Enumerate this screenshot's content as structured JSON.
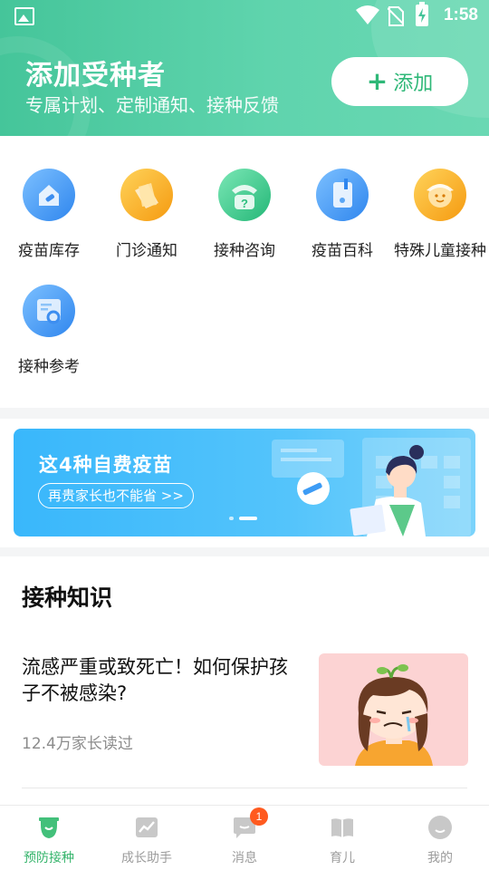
{
  "status_bar": {
    "time": "1:58"
  },
  "header": {
    "title": "添加受种者",
    "subtitle": "专属计划、定制通知、接种反馈",
    "add_button": {
      "plus": "+",
      "label": "添加"
    }
  },
  "quick_actions": [
    {
      "label": "疫苗库存",
      "icon": "vaccine-stock-icon",
      "color": "#3d9cf5"
    },
    {
      "label": "门诊通知",
      "icon": "clinic-notice-icon",
      "color": "#f8a71d"
    },
    {
      "label": "接种咨询",
      "icon": "consult-phone-icon",
      "color": "#3ec88a"
    },
    {
      "label": "疫苗百科",
      "icon": "vaccine-encyclopedia-icon",
      "color": "#3d9cf5"
    },
    {
      "label": "特殊儿童接种",
      "icon": "special-child-icon",
      "color": "#f8a71d"
    },
    {
      "label": "接种参考",
      "icon": "reference-doc-icon",
      "color": "#3d9cf5"
    }
  ],
  "banner": {
    "title": "这4种自费疫苗",
    "button_label": "再贵家长也不能省 >>",
    "pages_total": 2,
    "active_page": 2
  },
  "knowledge": {
    "section_title": "接种知识",
    "articles": [
      {
        "title": "流感严重或致死亡！如何保护孩子不被感染?",
        "meta": "12.4万家长读过"
      }
    ]
  },
  "tab_bar": {
    "tabs": [
      {
        "label": "预防接种",
        "icon": "vaccination-icon",
        "active": true
      },
      {
        "label": "成长助手",
        "icon": "growth-chart-icon",
        "active": false
      },
      {
        "label": "消息",
        "icon": "message-icon",
        "active": false,
        "badge": "1"
      },
      {
        "label": "育儿",
        "icon": "parenting-book-icon",
        "active": false
      },
      {
        "label": "我的",
        "icon": "profile-icon",
        "active": false
      }
    ]
  },
  "colors": {
    "accent": "#35b46b",
    "header": "#4fcaa0",
    "badge": "#ff5a1f",
    "banner": "#42bbfb"
  }
}
